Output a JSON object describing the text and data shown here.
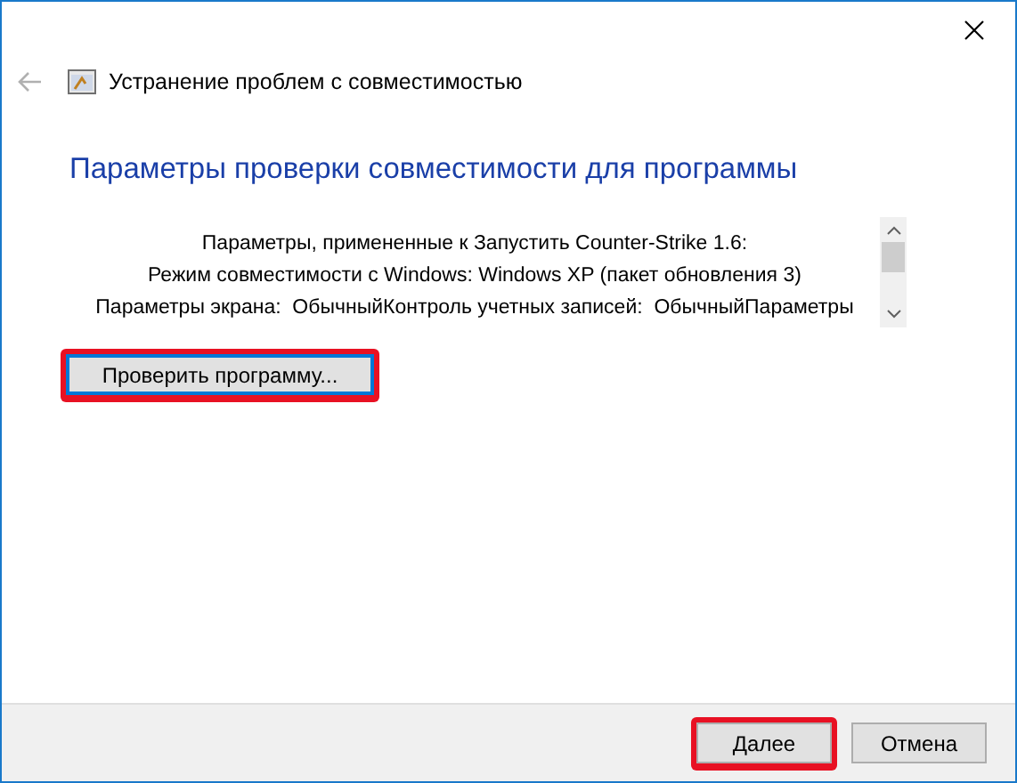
{
  "header": {
    "title": "Устранение проблем с совместимостью"
  },
  "heading": "Параметры проверки совместимости для программы",
  "settings_text": [
    "Параметры, примененные к Запустить Counter-Strike 1.6:",
    "Режим совместимости с Windows: Windows XP (пакет обновления 3)",
    "Параметры экрана:  ОбычныйКонтроль учетных записей:  ОбычныйПараметры"
  ],
  "test_button": {
    "label": "Проверить программу...",
    "highlighted": true,
    "focused": true
  },
  "footer_buttons": [
    {
      "label": "Далее",
      "highlighted": true
    },
    {
      "label": "Отмена",
      "highlighted": false
    }
  ]
}
